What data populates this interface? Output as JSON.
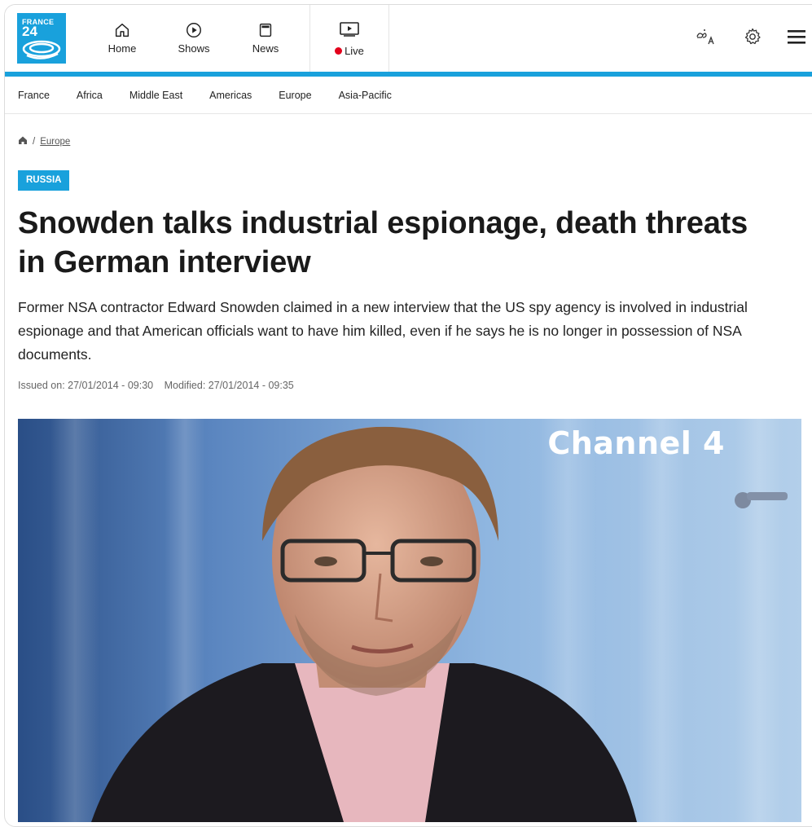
{
  "logo": {
    "line1": "FRANCE",
    "line2": "24"
  },
  "nav": {
    "items": [
      {
        "label": "Home",
        "icon": "home-icon"
      },
      {
        "label": "Shows",
        "icon": "play-circle-icon"
      },
      {
        "label": "News",
        "icon": "newspaper-icon"
      }
    ],
    "live": {
      "label": "Live",
      "icon": "live-tv-icon"
    }
  },
  "tools": {
    "language_icon": "language-icon",
    "settings_icon": "gear-icon",
    "menu_icon": "hamburger-menu-icon"
  },
  "regions": [
    "France",
    "Africa",
    "Middle East",
    "Americas",
    "Europe",
    "Asia-Pacific"
  ],
  "breadcrumb": {
    "home_icon": "home-icon",
    "separator": "/",
    "section": "Europe"
  },
  "article": {
    "tag": "RUSSIA",
    "headline": "Snowden talks industrial espionage, death threats in German interview",
    "lead": "Former NSA contractor Edward Snowden claimed in a new interview that the US spy agency is involved in industrial espionage and that American officials want to have him killed, even if he says he is no longer in possession of NSA documents.",
    "issued": "Issued on: 27/01/2014 - 09:30",
    "modified": "Modified: 27/01/2014 - 09:35",
    "photo_watermark": "Channel 4"
  },
  "colors": {
    "accent": "#19a1dc",
    "live": "#e3001b"
  }
}
